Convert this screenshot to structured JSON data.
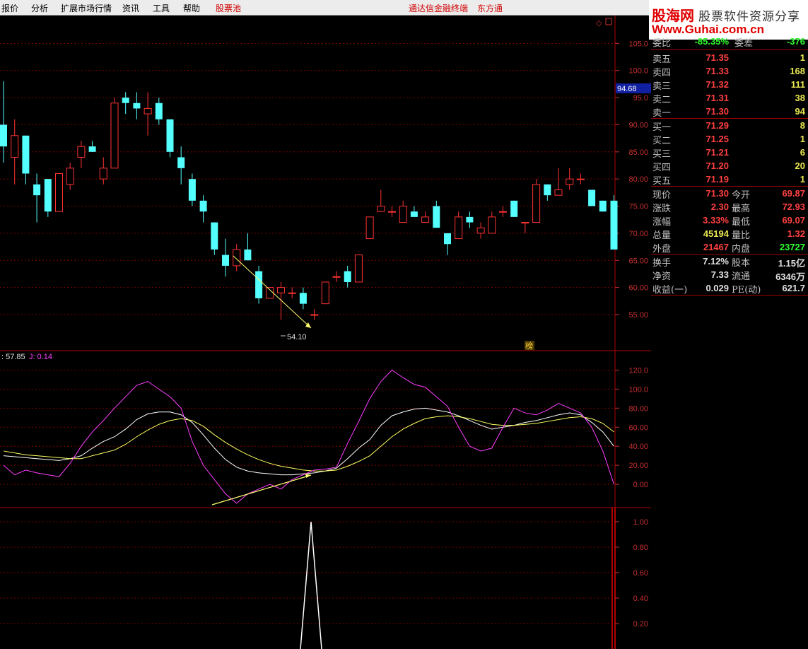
{
  "menu": {
    "items": [
      "报价",
      "分析",
      "扩展市场行情",
      "资讯",
      "工具",
      "帮助"
    ],
    "pool": "股票池",
    "brand1": "通达信金融终端",
    "brand2": "东方通"
  },
  "logo": {
    "name": "股海网",
    "slogan": "股票软件资源分享",
    "url": "Www.Guhai.com.cn"
  },
  "chart": {
    "price_marker": "94.68",
    "low_label": "54.10",
    "badge": "榜",
    "kdj_label_k": ": 57.85",
    "kdj_label_j": "J: 0.14",
    "axis_top": [
      "105.0",
      "100.0",
      "95.0",
      "90.00",
      "85.00",
      "80.00",
      "75.00",
      "70.00",
      "65.00",
      "60.00",
      "55.00"
    ],
    "axis_mid": [
      "120.0",
      "100.0",
      "80.00",
      "60.00",
      "40.00",
      "20.00",
      "0.00"
    ],
    "axis_bottom": [
      "1.00",
      "0.80",
      "0.60",
      "0.40",
      "0.20"
    ],
    "colors": {
      "up": "#ff3232",
      "down": "#54ffff",
      "k": "#ffffff",
      "d": "#ffff60",
      "j": "#ff40ff",
      "grid": "#7a0000"
    }
  },
  "chart_data": [
    {
      "type": "candlestick",
      "ylim": [
        52,
        107
      ],
      "bars": [
        {
          "o": 90,
          "h": 98,
          "l": 83,
          "c": 86
        },
        {
          "o": 84,
          "h": 91,
          "l": 79,
          "c": 88
        },
        {
          "o": 88,
          "h": 88,
          "l": 79,
          "c": 81
        },
        {
          "o": 79,
          "h": 81,
          "l": 72,
          "c": 77
        },
        {
          "o": 80,
          "h": 80,
          "l": 73,
          "c": 74
        },
        {
          "o": 74,
          "h": 81,
          "l": 74,
          "c": 81
        },
        {
          "o": 79,
          "h": 83,
          "l": 78,
          "c": 82
        },
        {
          "o": 84,
          "h": 87,
          "l": 82,
          "c": 86
        },
        {
          "o": 86,
          "h": 87,
          "l": 85,
          "c": 85
        },
        {
          "o": 80,
          "h": 84,
          "l": 79,
          "c": 82
        },
        {
          "o": 82,
          "h": 95,
          "l": 82,
          "c": 94
        },
        {
          "o": 95,
          "h": 96,
          "l": 92,
          "c": 94
        },
        {
          "o": 94,
          "h": 96,
          "l": 91,
          "c": 93
        },
        {
          "o": 92,
          "h": 96,
          "l": 88,
          "c": 93
        },
        {
          "o": 94,
          "h": 95,
          "l": 90,
          "c": 91
        },
        {
          "o": 91,
          "h": 91,
          "l": 84,
          "c": 85
        },
        {
          "o": 84,
          "h": 86,
          "l": 79,
          "c": 82
        },
        {
          "o": 80,
          "h": 81,
          "l": 75,
          "c": 76
        },
        {
          "o": 76,
          "h": 77,
          "l": 72,
          "c": 74
        },
        {
          "o": 72,
          "h": 72,
          "l": 66,
          "c": 67
        },
        {
          "o": 66,
          "h": 69,
          "l": 62,
          "c": 64
        },
        {
          "o": 64,
          "h": 68,
          "l": 63,
          "c": 67
        },
        {
          "o": 67,
          "h": 70,
          "l": 65,
          "c": 65
        },
        {
          "o": 63,
          "h": 64,
          "l": 57,
          "c": 58
        },
        {
          "o": 58,
          "h": 60,
          "l": 58,
          "c": 60
        },
        {
          "o": 59,
          "h": 61,
          "l": 54,
          "c": 60
        },
        {
          "o": 59,
          "h": 60,
          "l": 58,
          "c": 59
        },
        {
          "o": 59,
          "h": 60,
          "l": 56,
          "c": 57
        },
        {
          "o": 55,
          "h": 56,
          "l": 54,
          "c": 55
        },
        {
          "o": 57,
          "h": 61,
          "l": 57,
          "c": 61
        },
        {
          "o": 62,
          "h": 63,
          "l": 61,
          "c": 62
        },
        {
          "o": 63,
          "h": 64,
          "l": 60,
          "c": 61
        },
        {
          "o": 61,
          "h": 66,
          "l": 61,
          "c": 66
        },
        {
          "o": 69,
          "h": 73,
          "l": 69,
          "c": 73
        },
        {
          "o": 74,
          "h": 78,
          "l": 74,
          "c": 75
        },
        {
          "o": 74,
          "h": 75,
          "l": 73,
          "c": 74
        },
        {
          "o": 72,
          "h": 76,
          "l": 72,
          "c": 75
        },
        {
          "o": 74,
          "h": 75,
          "l": 73,
          "c": 73
        },
        {
          "o": 72,
          "h": 74,
          "l": 72,
          "c": 73
        },
        {
          "o": 75,
          "h": 76,
          "l": 71,
          "c": 71
        },
        {
          "o": 70,
          "h": 70,
          "l": 66,
          "c": 68
        },
        {
          "o": 69,
          "h": 74,
          "l": 69,
          "c": 73
        },
        {
          "o": 73,
          "h": 74,
          "l": 71,
          "c": 72
        },
        {
          "o": 70,
          "h": 72,
          "l": 69,
          "c": 71
        },
        {
          "o": 70,
          "h": 74,
          "l": 70,
          "c": 73
        },
        {
          "o": 74,
          "h": 75,
          "l": 73,
          "c": 74
        },
        {
          "o": 76,
          "h": 76,
          "l": 73,
          "c": 73
        },
        {
          "o": 72,
          "h": 72,
          "l": 70,
          "c": 72
        },
        {
          "o": 72,
          "h": 80,
          "l": 72,
          "c": 79
        },
        {
          "o": 79,
          "h": 79,
          "l": 76,
          "c": 77
        },
        {
          "o": 77,
          "h": 82,
          "l": 77,
          "c": 78
        },
        {
          "o": 79,
          "h": 82,
          "l": 78,
          "c": 80
        },
        {
          "o": 80,
          "h": 81,
          "l": 79,
          "c": 80
        },
        {
          "o": 78,
          "h": 78,
          "l": 75,
          "c": 75
        },
        {
          "o": 76,
          "h": 76,
          "l": 74,
          "c": 74
        },
        {
          "o": 76,
          "h": 77,
          "l": 67,
          "c": 67
        }
      ]
    },
    {
      "type": "line",
      "ylim": [
        -20,
        130
      ],
      "series": [
        {
          "name": "K",
          "values": [
            30,
            29,
            28,
            27,
            26,
            25,
            27,
            30,
            38,
            45,
            50,
            58,
            68,
            74,
            76,
            76,
            73,
            65,
            52,
            38,
            26,
            18,
            14,
            12,
            11,
            10,
            10,
            11,
            12,
            14,
            17,
            27,
            38,
            47,
            62,
            72,
            76,
            79,
            80,
            78,
            76,
            72,
            67,
            62,
            58,
            60,
            62,
            65,
            67,
            70,
            73,
            75,
            73,
            65,
            55,
            40
          ]
        },
        {
          "name": "D",
          "values": [
            35,
            33,
            31,
            30,
            29,
            28,
            27,
            27,
            30,
            33,
            36,
            42,
            50,
            57,
            63,
            67,
            69,
            67,
            61,
            52,
            44,
            37,
            31,
            26,
            22,
            19,
            17,
            15,
            14,
            14,
            15,
            19,
            24,
            30,
            40,
            50,
            58,
            64,
            69,
            71,
            72,
            71,
            69,
            66,
            63,
            62,
            62,
            63,
            64,
            66,
            68,
            70,
            71,
            69,
            64,
            55
          ]
        },
        {
          "name": "J",
          "values": [
            20,
            10,
            15,
            12,
            10,
            8,
            22,
            40,
            55,
            67,
            80,
            92,
            104,
            108,
            100,
            92,
            80,
            45,
            20,
            5,
            -10,
            -20,
            -10,
            -5,
            0,
            -5,
            5,
            10,
            15,
            16,
            18,
            43,
            66,
            90,
            108,
            120,
            112,
            105,
            102,
            92,
            82,
            60,
            40,
            35,
            38,
            60,
            80,
            75,
            73,
            78,
            85,
            80,
            75,
            60,
            35,
            0
          ]
        }
      ]
    }
  ],
  "quote": {
    "top_label": "委比",
    "top_val": "-85.35%",
    "top_label2": "委差",
    "top_val2": "-376",
    "asks": [
      {
        "label": "卖五",
        "price": "71.35",
        "vol": "1"
      },
      {
        "label": "卖四",
        "price": "71.33",
        "vol": "168"
      },
      {
        "label": "卖三",
        "price": "71.32",
        "vol": "111"
      },
      {
        "label": "卖二",
        "price": "71.31",
        "vol": "38"
      },
      {
        "label": "卖一",
        "price": "71.30",
        "vol": "94"
      }
    ],
    "bids": [
      {
        "label": "买一",
        "price": "71.29",
        "vol": "8"
      },
      {
        "label": "买二",
        "price": "71.25",
        "vol": "1"
      },
      {
        "label": "买三",
        "price": "71.21",
        "vol": "6"
      },
      {
        "label": "买四",
        "price": "71.20",
        "vol": "20"
      },
      {
        "label": "买五",
        "price": "71.19",
        "vol": "1"
      }
    ],
    "stats": [
      {
        "l1": "现价",
        "v1": "71.30",
        "c1": "red",
        "l2": "今开",
        "v2": "69.87",
        "c2": "red"
      },
      {
        "l1": "涨跌",
        "v1": "2.30",
        "c1": "red",
        "l2": "最高",
        "v2": "72.93",
        "c2": "red"
      },
      {
        "l1": "涨幅",
        "v1": "3.33%",
        "c1": "red",
        "l2": "最低",
        "v2": "69.07",
        "c2": "red"
      },
      {
        "l1": "总量",
        "v1": "45194",
        "c1": "yel",
        "l2": "量比",
        "v2": "1.32",
        "c2": "red"
      },
      {
        "l1": "外盘",
        "v1": "21467",
        "c1": "red",
        "l2": "内盘",
        "v2": "23727",
        "c2": "grn"
      }
    ],
    "fund": [
      {
        "l1": "换手",
        "v1": "7.12%",
        "l2": "股本",
        "v2": "1.15亿"
      },
      {
        "l1": "净资",
        "v1": "7.33",
        "l2": "流通",
        "v2": "6346万"
      },
      {
        "l1": "收益(一)",
        "v1": "0.029",
        "l2": "PE(动)",
        "v2": "621.7"
      }
    ]
  }
}
